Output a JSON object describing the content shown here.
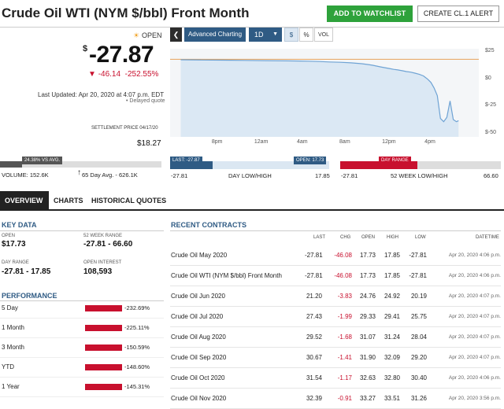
{
  "header": {
    "title": "Crude Oil WTI (NYM $/bbl) Front Month",
    "watchlist_btn": "ADD TO WATCHLIST",
    "alert_btn": "CREATE CL.1 ALERT"
  },
  "quote": {
    "status": "OPEN",
    "currency": "$",
    "price": "-27.87",
    "change": "-46.14",
    "change_pct": "-252.55%",
    "updated": "Last Updated: Apr 20, 2020 at 4:07 p.m. EDT",
    "delayed": "Delayed quote",
    "settle_label": "SETTLEMENT PRICE 04/17/20",
    "settle_value": "$18.27"
  },
  "chart_toolbar": {
    "advanced": "Advanced Charting",
    "period": "1D",
    "dollar": "$",
    "percent": "%",
    "vol": "VOL"
  },
  "chart_data": {
    "type": "line",
    "x_ticks": [
      "8pm",
      "12am",
      "4am",
      "8am",
      "12pm",
      "4pm"
    ],
    "y_ticks": [
      "$25",
      "$0",
      "$-25",
      "$-50"
    ],
    "ylim": [
      -50,
      25
    ],
    "reference_line": 18.27,
    "x_hours": [
      0,
      2,
      4,
      6,
      8,
      10,
      12,
      13,
      14,
      15,
      16,
      17,
      17.5,
      18,
      18.4,
      18.8,
      19.2,
      19.6,
      20,
      20.4,
      20.8,
      21.2,
      21.6,
      22,
      22.4,
      22.8,
      23,
      23.2,
      23.5,
      23.8,
      24.1,
      24.4,
      24.7,
      25,
      25.3,
      25.6,
      25.9,
      26.1
    ],
    "values": [
      17.8,
      17.6,
      17.4,
      17.2,
      17.0,
      16.8,
      16.5,
      16.2,
      15.8,
      15.5,
      15.0,
      14.2,
      13.5,
      12.8,
      12.0,
      11.2,
      10.5,
      9.8,
      9.0,
      8.5,
      7.8,
      7.0,
      6.5,
      5.5,
      4.5,
      3.0,
      1.5,
      0.0,
      -3.0,
      -8.0,
      -15.0,
      -36.0,
      -39.0,
      -35.0,
      -20.0,
      -37.0,
      -39.0,
      -38.0
    ],
    "x_range": [
      -1,
      28
    ]
  },
  "volume": {
    "pct_tag": "24.38% VS AVG.",
    "volume": "VOLUME: 152.6K",
    "avg": "65 Day Avg. - 626.1K"
  },
  "day_range": {
    "last_tag": "LAST: -27.87",
    "open_tag": "OPEN: 17.73",
    "low": "-27.81",
    "label": "DAY LOW/HIGH",
    "high": "17.85"
  },
  "week52": {
    "tag": "DAY RANGE",
    "low": "-27.81",
    "label": "52 WEEK LOW/HIGH",
    "high": "66.60"
  },
  "tabs": [
    "OVERVIEW",
    "CHARTS",
    "HISTORICAL QUOTES"
  ],
  "key_data": {
    "heading": "KEY DATA",
    "open_lbl": "OPEN",
    "open_val": "$17.73",
    "wk52_lbl": "52 WEEK RANGE",
    "wk52_val": "-27.81 - 66.60",
    "day_lbl": "DAY RANGE",
    "day_val": "-27.81 - 17.85",
    "oi_lbl": "OPEN INTEREST",
    "oi_val": "108,593"
  },
  "performance": {
    "heading": "PERFORMANCE",
    "rows": [
      {
        "label": "5 Day",
        "value": "-232.69%"
      },
      {
        "label": "1 Month",
        "value": "-225.11%"
      },
      {
        "label": "3 Month",
        "value": "-150.59%"
      },
      {
        "label": "YTD",
        "value": "-148.60%"
      },
      {
        "label": "1 Year",
        "value": "-145.31%"
      }
    ]
  },
  "contracts": {
    "heading": "RECENT CONTRACTS",
    "columns": [
      "LAST",
      "CHG",
      "OPEN",
      "HIGH",
      "LOW",
      "DATETIME"
    ],
    "rows": [
      {
        "name": "Crude Oil May 2020",
        "last": "-27.81",
        "chg": "-46.08",
        "open": "17.73",
        "high": "17.85",
        "low": "-27.81",
        "dt": "Apr 20, 2020 4:06 p.m."
      },
      {
        "name": "Crude Oil WTI (NYM $/bbl) Front Month",
        "last": "-27.81",
        "chg": "-46.08",
        "open": "17.73",
        "high": "17.85",
        "low": "-27.81",
        "dt": "Apr 20, 2020 4:06 p.m."
      },
      {
        "name": "Crude Oil Jun 2020",
        "last": "21.20",
        "chg": "-3.83",
        "open": "24.76",
        "high": "24.92",
        "low": "20.19",
        "dt": "Apr 20, 2020 4:07 p.m."
      },
      {
        "name": "Crude Oil Jul 2020",
        "last": "27.43",
        "chg": "-1.99",
        "open": "29.33",
        "high": "29.41",
        "low": "25.75",
        "dt": "Apr 20, 2020 4:07 p.m."
      },
      {
        "name": "Crude Oil Aug 2020",
        "last": "29.52",
        "chg": "-1.68",
        "open": "31.07",
        "high": "31.24",
        "low": "28.04",
        "dt": "Apr 20, 2020 4:07 p.m."
      },
      {
        "name": "Crude Oil Sep 2020",
        "last": "30.67",
        "chg": "-1.41",
        "open": "31.90",
        "high": "32.09",
        "low": "29.20",
        "dt": "Apr 20, 2020 4:07 p.m."
      },
      {
        "name": "Crude Oil Oct 2020",
        "last": "31.54",
        "chg": "-1.17",
        "open": "32.63",
        "high": "32.80",
        "low": "30.40",
        "dt": "Apr 20, 2020 4:06 p.m."
      },
      {
        "name": "Crude Oil Nov 2020",
        "last": "32.39",
        "chg": "-0.91",
        "open": "33.27",
        "high": "33.51",
        "low": "31.26",
        "dt": "Apr 20, 2020 3:56 p.m."
      }
    ]
  },
  "colors": {
    "accent_blue": "#2f5b84",
    "negative": "#c8102e",
    "positive": "#2ea23b"
  }
}
